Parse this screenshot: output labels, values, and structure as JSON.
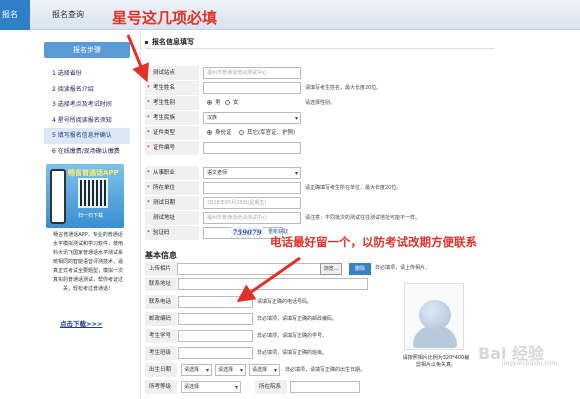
{
  "header": {
    "tab_active": "报名",
    "tab_query": "报名查询"
  },
  "sidebar": {
    "title": "报名步骤",
    "steps": [
      {
        "label": "1 选择省份"
      },
      {
        "label": "2 阅读报名介绍"
      },
      {
        "label": "3 选择考点及考试时间"
      },
      {
        "label": "4 星号所阅读报名须知"
      },
      {
        "label": "5 填写报名信息并确认"
      },
      {
        "label": "6 在线缴费/现场确认缴费"
      }
    ],
    "current_step": 4,
    "app_title": "畅言普通话APP",
    "qr_note": "扫一扫下载",
    "app_desc": "畅言普通话APP，专业的普通话水平模拟测试和学习软件，使用科大讯飞国家普通话水平测试系统相同的智能语音评测技术，逼真正式考试全要题型，模拟一次真实的普通话测试，帮你考证过关，轻松考过普通话！",
    "download": "点击下载>>>"
  },
  "form": {
    "section_title": "报名信息填写",
    "rows": [
      {
        "label": "测试站点",
        "required": false,
        "value": "福州市普通话培训测试中心",
        "tip": ""
      },
      {
        "label": "考生姓名",
        "required": true,
        "value": "",
        "tip": "请填写考生姓名，最大长度20位。"
      },
      {
        "label": "考生性别",
        "required": true,
        "value": "",
        "tip": "请选择性别。",
        "options": [
          "男",
          "女"
        ]
      },
      {
        "label": "考生民族",
        "required": true,
        "value": "汉族",
        "tip": ""
      },
      {
        "label": "证件类型",
        "required": true,
        "value": "",
        "tip": "",
        "options": [
          "身份证",
          "其它(军官证、护照)"
        ]
      },
      {
        "label": "证件编号",
        "required": true,
        "value": "",
        "tip": ""
      },
      {
        "label": "从事职业",
        "required": true,
        "value": "语文老师",
        "tip": ""
      },
      {
        "label": "所在单位",
        "required": true,
        "value": "",
        "tip": "请正确填写考生所在单位，最大长度20位。"
      },
      {
        "label": "测试日期",
        "required": true,
        "value": "2018年05月28日(星期五)",
        "tip": ""
      },
      {
        "label": "测试地址",
        "required": false,
        "value": "福州市普通话培训测试中心",
        "tip": "请注意：不同批次的测试往往测试地址可能不一样。"
      },
      {
        "label": "验证码",
        "required": true,
        "value": "",
        "tip": ""
      }
    ],
    "captcha": "759079",
    "refresh": "重新获取"
  },
  "basic": {
    "title": "基本信息",
    "upload_label": "上传相片",
    "browse": "浏览...",
    "upload_btn": "删除",
    "upload_tip": "非必填项，请上传相片。",
    "rows": [
      {
        "label": "联系地址",
        "tip": ""
      },
      {
        "label": "联系电话",
        "tip": "请填写正确的电话号码。"
      },
      {
        "label": "邮政编码",
        "tip": "非必填项，请填写正确的邮政编码。"
      },
      {
        "label": "考生学号",
        "tip": "非必填项，请填写正确的学号。"
      },
      {
        "label": "考生班级",
        "tip": "非必填项，请填写正确的班级。"
      },
      {
        "label": "出生日期",
        "tip": "非必填项，请填写正确的出生日期。"
      },
      {
        "label": "所考等级",
        "tip": ""
      }
    ],
    "dob_selects": [
      "请选择",
      "请选择",
      "请选择"
    ],
    "grade_select": "请选择",
    "extra_label": "所在院系",
    "photo_tip": "请按照相片比例为320*400裁剪相片以免失真。"
  },
  "annotations": {
    "top": "星号这几项必填",
    "phone": "电话最好留一个，以防考试改期方便联系"
  },
  "watermark": {
    "text": "Bai 经验",
    "sub": "jingyan.baidu.com"
  },
  "colors": {
    "annotation": "#e0322a",
    "accent": "#2f80c9"
  }
}
